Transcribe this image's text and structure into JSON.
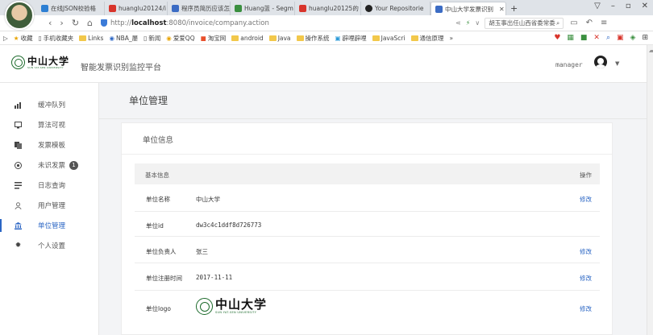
{
  "browser": {
    "tabs": [
      {
        "label": "在线JSON校验格",
        "color": "#2d7fd3"
      },
      {
        "label": "huanglu20124/i",
        "color": "#d8342b"
      },
      {
        "label": "程序员简历应该怎",
        "color": "#3c6cc4"
      },
      {
        "label": "Huang蓝 - Segm",
        "color": "#3a8f3f"
      },
      {
        "label": "huanglu20125的",
        "color": "#d8342b"
      },
      {
        "label": "Your Repositorie",
        "color": "#222222"
      },
      {
        "label": "中山大学发票识别",
        "color": "#3c6cc4",
        "active": true
      }
    ],
    "url_prefix": "http://",
    "url_host": "localhost",
    "url_rest": ":8080/invoice/company.action",
    "search_text": "胡玉事出任山西省委常委"
  },
  "bookmarks": [
    "收藏",
    "手机收藏夹",
    "Links",
    "NBA_屡",
    "新闻",
    "爱爱QQ",
    "淘宝网",
    "android",
    "Java",
    "操作系统",
    "辟哩辟哩",
    "JavaScri",
    "通信原理",
    "»"
  ],
  "header": {
    "logo_cn": "中山大学",
    "logo_en": "SUN YAT-SEN UNIVERSITY",
    "app_title": "智能发票识别监控平台",
    "username": "manager"
  },
  "sidebar": {
    "items": [
      {
        "label": "缓冲队列",
        "icon": "bar-chart-icon"
      },
      {
        "label": "算法可视",
        "icon": "monitor-icon"
      },
      {
        "label": "发票模板",
        "icon": "copy-icon"
      },
      {
        "label": "未识发票",
        "icon": "target-icon",
        "badge": "1"
      },
      {
        "label": "日志查询",
        "icon": "list-icon"
      },
      {
        "label": "用户管理",
        "icon": "user-icon"
      },
      {
        "label": "单位管理",
        "icon": "bank-icon",
        "active": true
      },
      {
        "label": "个人设置",
        "icon": "gear-icon"
      }
    ]
  },
  "main": {
    "page_title": "单位管理",
    "panel_title": "单位信息",
    "table": {
      "col_basic": "基本信息",
      "col_action": "操作",
      "rows": [
        {
          "key": "单位名称",
          "value": "中山大学",
          "action": "修改"
        },
        {
          "key": "单位id",
          "value": "dw3c4c1ddf8d726773",
          "action": ""
        },
        {
          "key": "单位负责人",
          "value": "张三",
          "action": "修改"
        },
        {
          "key": "单位注册时间",
          "value": "2017-11-11",
          "action": "修改"
        },
        {
          "key": "单位logo",
          "value": "",
          "action": "修改"
        }
      ]
    }
  }
}
